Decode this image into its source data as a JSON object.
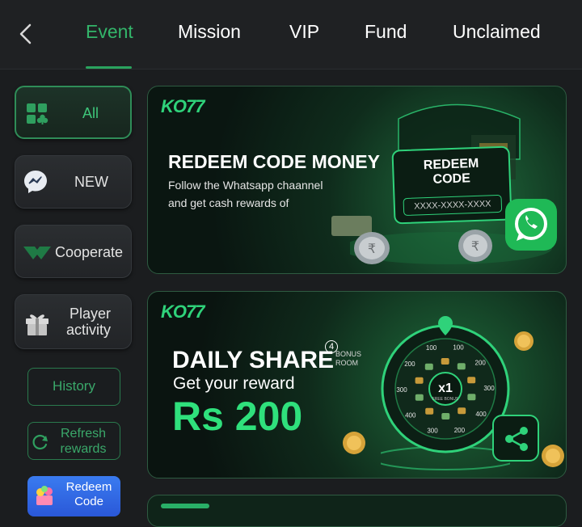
{
  "tabs": [
    {
      "label": "Event",
      "active": true
    },
    {
      "label": "Mission"
    },
    {
      "label": "VIP"
    },
    {
      "label": "Fund"
    },
    {
      "label": "Unclaimed"
    }
  ],
  "sidebar": {
    "items": [
      {
        "label": "All",
        "icon": "grid-club-icon",
        "active": true
      },
      {
        "label": "NEW",
        "icon": "messenger-icon"
      },
      {
        "label": "Cooperate",
        "icon": "handshake-icon"
      },
      {
        "label": "Player activity",
        "label_line1": "Player",
        "label_line2": "activity",
        "icon": "gift-icon"
      }
    ],
    "history_label": "History",
    "refresh_line1": "Refresh",
    "refresh_line2": "rewards",
    "redeem_line1": "Redeem",
    "redeem_line2": "Code"
  },
  "banners": [
    {
      "logo": "KO77",
      "title": "REDEEM CODE MONEY",
      "line1": "Follow the Whatsapp chaannel",
      "line2": "and get cash rewards of",
      "card_title_1": "REDEEM",
      "card_title_2": "CODE",
      "card_code": "XXXX-XXXX-XXXX"
    },
    {
      "logo": "KO77",
      "title": "DAILY SHARE",
      "badge": "4",
      "bonus_1": "BONUS",
      "bonus_2": "ROOM",
      "subtitle": "Get your reward",
      "amount": "Rs 200",
      "wheel_center": "x1",
      "wheel_center_sub": "FREE BONUS",
      "wheel_values": [
        "100",
        "200",
        "300",
        "400",
        "200",
        "300",
        "400",
        "300",
        "200",
        "100"
      ]
    }
  ],
  "colors": {
    "accent": "#33b56a",
    "background": "#1b1d1f",
    "banner_green": "#2fd27a"
  }
}
